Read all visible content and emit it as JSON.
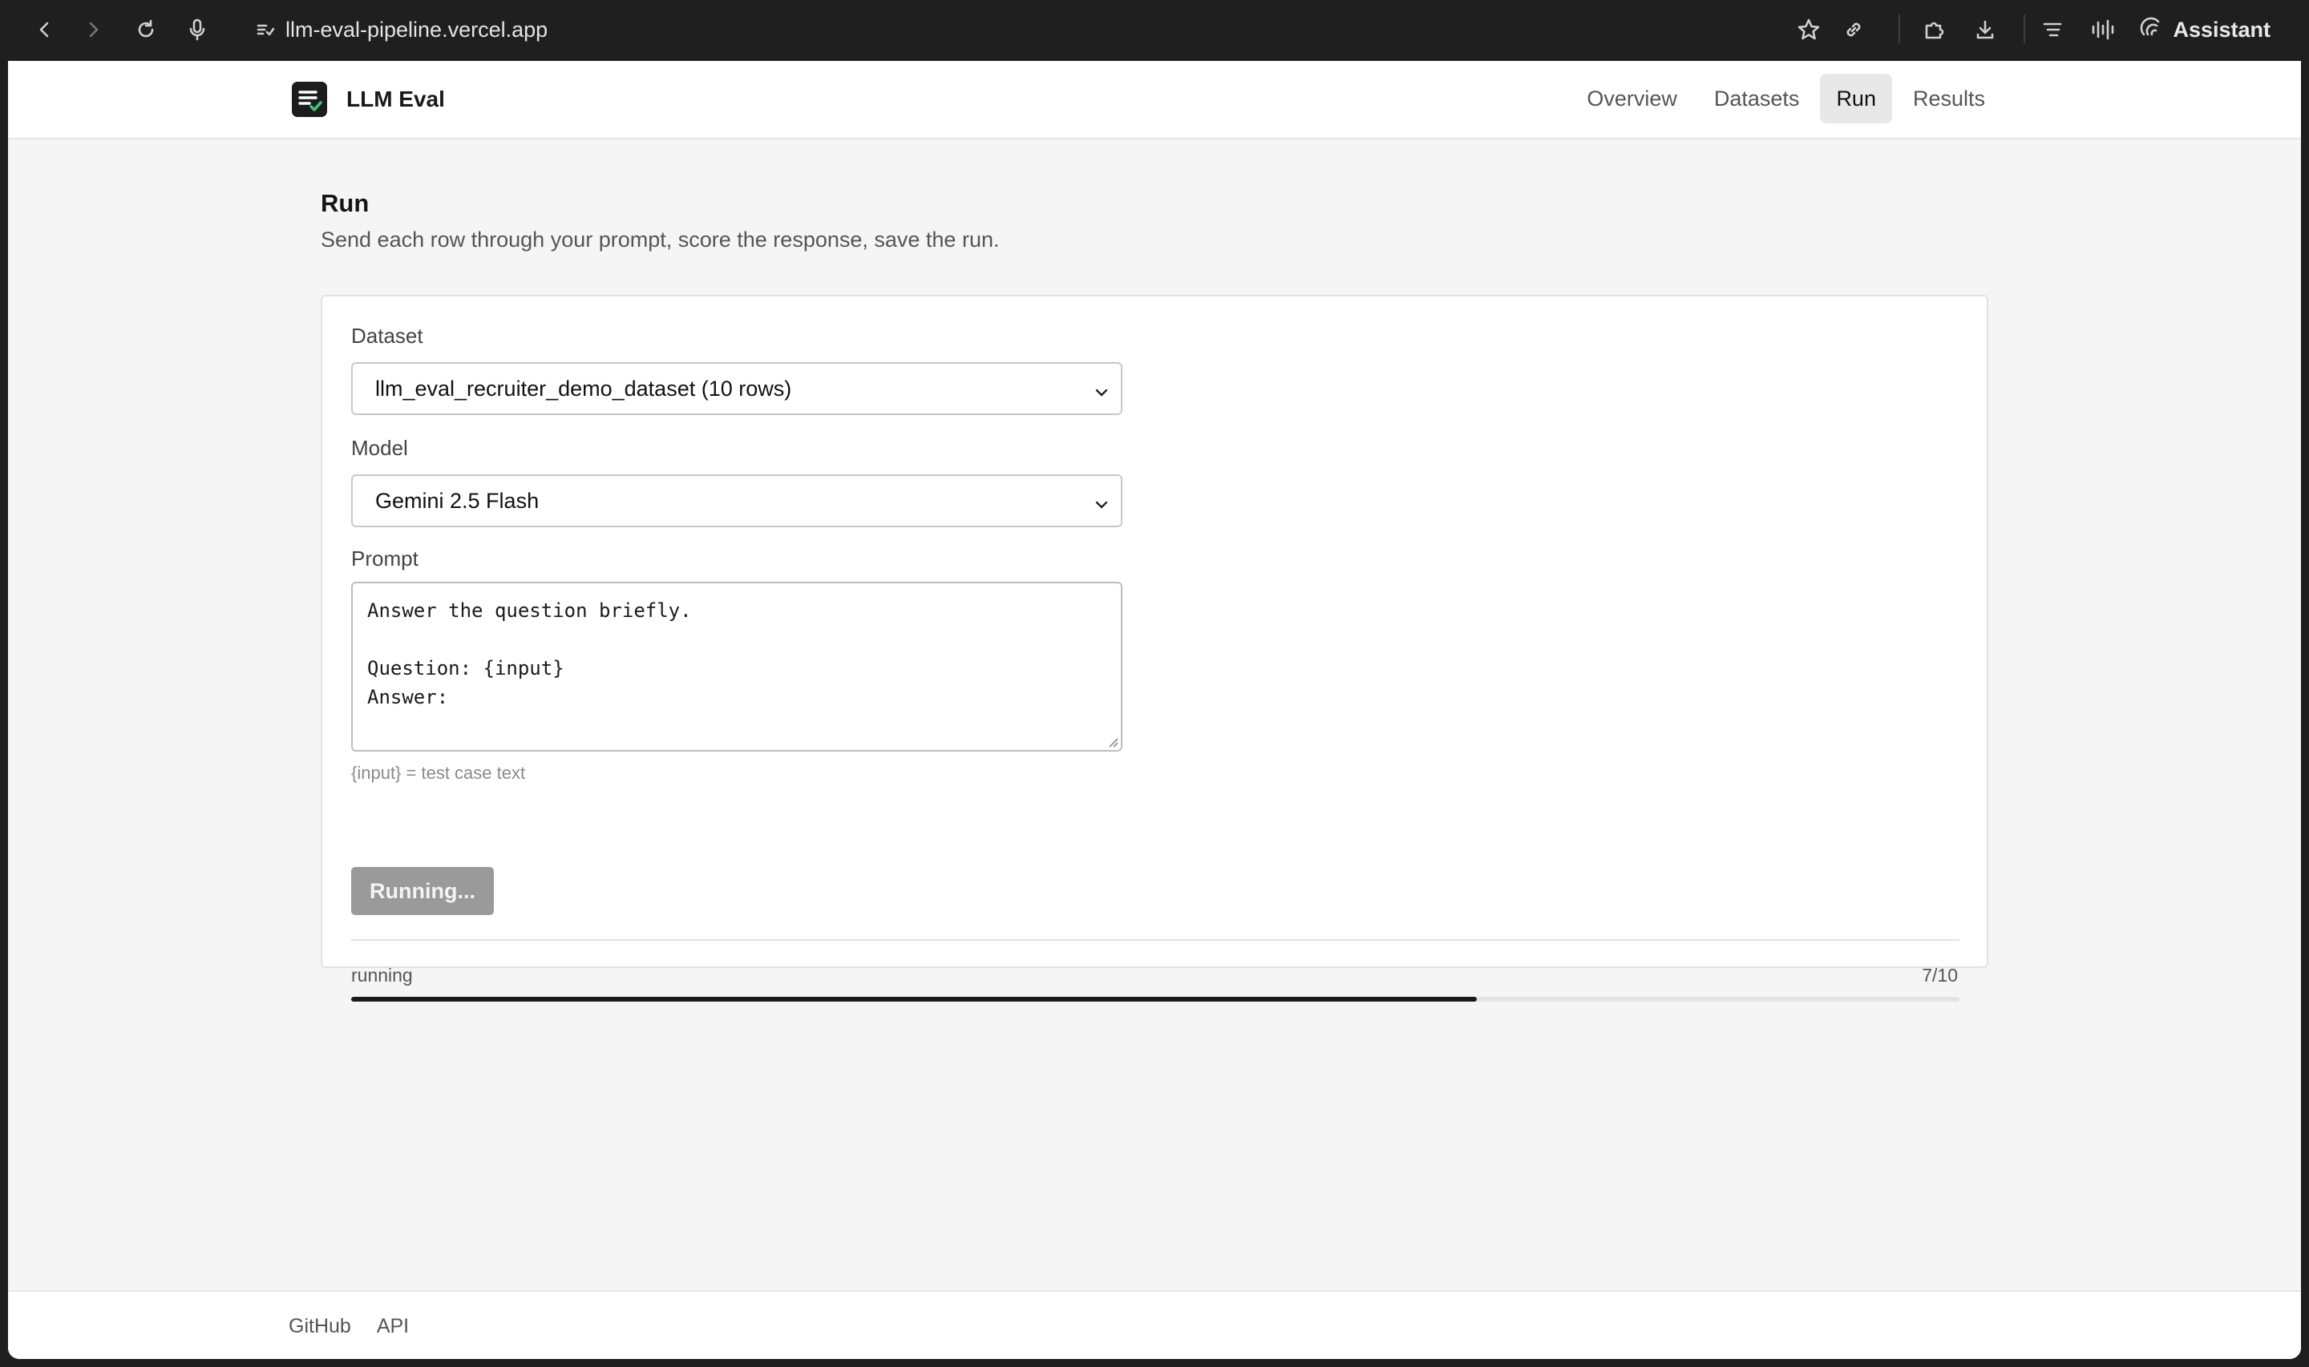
{
  "browser": {
    "url": "llm-eval-pipeline.vercel.app",
    "assistant_label": "Assistant"
  },
  "app": {
    "name": "LLM Eval",
    "nav": [
      {
        "label": "Overview",
        "active": false
      },
      {
        "label": "Datasets",
        "active": false
      },
      {
        "label": "Run",
        "active": true
      },
      {
        "label": "Results",
        "active": false
      }
    ]
  },
  "page": {
    "title": "Run",
    "subtitle": "Send each row through your prompt, score the response, save the run."
  },
  "form": {
    "dataset_label": "Dataset",
    "dataset_value": "llm_eval_recruiter_demo_dataset (10 rows)",
    "model_label": "Model",
    "model_value": "Gemini 2.5 Flash",
    "prompt_label": "Prompt",
    "prompt_value": "Answer the question briefly.\n\nQuestion: {input}\nAnswer:",
    "prompt_hint": "{input} = test case text",
    "run_button": "Running..."
  },
  "progress": {
    "status": "running",
    "count": "7/10",
    "fraction": 0.7
  },
  "footer": {
    "links": [
      "GitHub",
      "API"
    ]
  },
  "colors": {
    "accent": "#1a1a1a",
    "logo_check": "#3cc47a"
  }
}
